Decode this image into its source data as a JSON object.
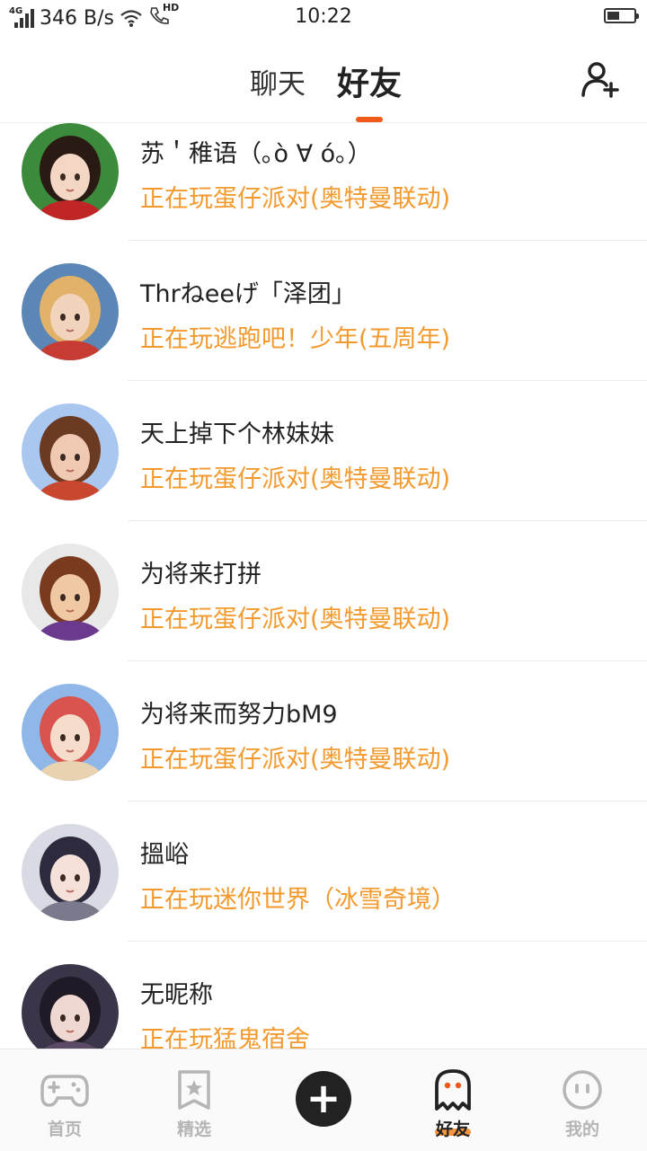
{
  "status_bar": {
    "network": "4G",
    "speed": "346 B/s",
    "call_tag": "HD",
    "time": "10:22",
    "battery_level": 0.45
  },
  "header": {
    "tab_chat": "聊天",
    "tab_friends": "好友",
    "add_friend_icon": "add-user-icon"
  },
  "friends": [
    {
      "name": "苏＇稚语（｡ò ∀ ó｡）",
      "status": "正在玩蛋仔派对(奥特曼联动)",
      "avatar_colors": [
        "#3c8b3c",
        "#2a1a14",
        "#f3d6c4",
        "#c12626"
      ]
    },
    {
      "name": "Thrねeeげ「泽团」",
      "status": "正在玩逃跑吧！少年(五周年)",
      "avatar_colors": [
        "#5b86b5",
        "#e3b26a",
        "#f2d4bd",
        "#c63b32"
      ]
    },
    {
      "name": "天上掉下个林妹妹",
      "status": "正在玩蛋仔派对(奥特曼联动)",
      "avatar_colors": [
        "#aac8ef",
        "#6b3a22",
        "#f0c9b3",
        "#c9462f"
      ]
    },
    {
      "name": "为将来打拼",
      "status": "正在玩蛋仔派对(奥特曼联动)",
      "avatar_colors": [
        "#e8e8e8",
        "#7a3a1e",
        "#f0c9a4",
        "#6b3a8e"
      ]
    },
    {
      "name": "为将来而努力bM9",
      "status": "正在玩蛋仔派对(奥特曼联动)",
      "avatar_colors": [
        "#8fb8e8",
        "#d9544e",
        "#f6dccb",
        "#e9d2b0"
      ]
    },
    {
      "name": "搵峪",
      "status": "正在玩迷你世界（冰雪奇境）",
      "avatar_colors": [
        "#d8dbe3",
        "#2c2a3c",
        "#f6e1da",
        "#7b7a8c"
      ]
    },
    {
      "name": "无昵称",
      "status": "正在玩猛鬼宿舍",
      "avatar_colors": [
        "#3a3548",
        "#1f1a26",
        "#f0d8d2",
        "#5b4a66"
      ]
    }
  ],
  "bottom_nav": [
    {
      "label": "首页",
      "icon": "gamepad-icon"
    },
    {
      "label": "精选",
      "icon": "star-badge-icon"
    },
    {
      "label": "",
      "icon": "plus-icon"
    },
    {
      "label": "好友",
      "icon": "ghost-icon"
    },
    {
      "label": "我的",
      "icon": "face-icon"
    }
  ],
  "colors": {
    "accent": "#f05a1a",
    "status_orange": "#f39a2e",
    "text": "#222222",
    "inactive": "#b5b5b5"
  }
}
